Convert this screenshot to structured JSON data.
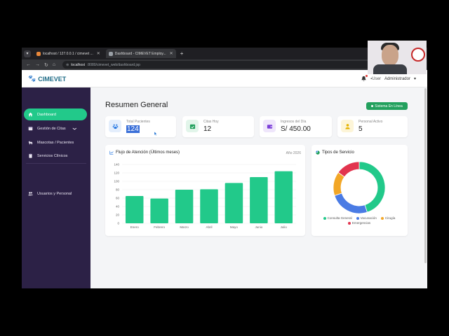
{
  "browser": {
    "tabs": [
      {
        "title": "localhost / 127.0.0.1 / cimevet ...",
        "active": false
      },
      {
        "title": "Dashboard - CIMEVET Employ...",
        "active": true
      }
    ],
    "new_tab": "+",
    "url_host": "localhost",
    "url_path": ":8080/cimevet_web/dashboard.jsp"
  },
  "header": {
    "brand": "CIMEVET",
    "user_img_alt": "User",
    "user_role": "Administrador"
  },
  "sidebar": {
    "items": [
      {
        "label": "Dashboard",
        "active": true,
        "icon": "home-icon"
      },
      {
        "label": "Gestión de Citas",
        "active": false,
        "icon": "calendar-icon",
        "chevron": "❯"
      },
      {
        "label": "Mascotas / Pacientes",
        "active": false,
        "icon": "dog-icon"
      },
      {
        "label": "Servicios Clínicos",
        "active": false,
        "icon": "clipboard-icon"
      },
      {
        "label": "Usuarios y Personal",
        "active": false,
        "icon": "users-icon"
      }
    ]
  },
  "main": {
    "title": "Resumen General",
    "status": "Sistema En Línea",
    "cards": [
      {
        "label": "Total Pacientes",
        "value": "124",
        "icon": "paw-icon",
        "color": "#2b7be4",
        "bg": "#e4eefc"
      },
      {
        "label": "Citas Hoy",
        "value": "12",
        "icon": "calendar-check-icon",
        "color": "#22a05d",
        "bg": "#e2f5ea"
      },
      {
        "label": "Ingresos del Día",
        "value": "S/ 450.00",
        "icon": "wallet-icon",
        "color": "#7b3fd8",
        "bg": "#efe6fb"
      },
      {
        "label": "Personal Activo",
        "value": "5",
        "icon": "person-icon",
        "color": "#e5b300",
        "bg": "#fdf5d8"
      }
    ],
    "flow_panel": {
      "title": "Flujo de Atención (Últimos meses)",
      "year_label": "Año 2026"
    },
    "service_panel": {
      "title": "Tipos de Servicio"
    }
  },
  "chart_data": [
    {
      "type": "bar",
      "title": "Flujo de Atención (Últimos meses)",
      "categories": [
        "Enero",
        "Febrero",
        "Marzo",
        "Abril",
        "Mayo",
        "Junio",
        "Julio"
      ],
      "values": [
        65,
        59,
        80,
        81,
        96,
        110,
        124
      ],
      "ylim": [
        0,
        140
      ],
      "yticks": [
        0,
        20,
        40,
        60,
        80,
        100,
        120,
        140
      ],
      "color": "#22c98a",
      "grid": true
    },
    {
      "type": "pie",
      "title": "Tipos de Servicio",
      "donut": true,
      "labels": [
        "Consulta General",
        "Vacunación",
        "Cirugía",
        "Emergencias"
      ],
      "values": [
        45,
        25,
        15,
        15
      ],
      "colors": [
        "#22c98a",
        "#4a7be4",
        "#f2a626",
        "#e2344e"
      ],
      "legend": "bottom"
    }
  ]
}
